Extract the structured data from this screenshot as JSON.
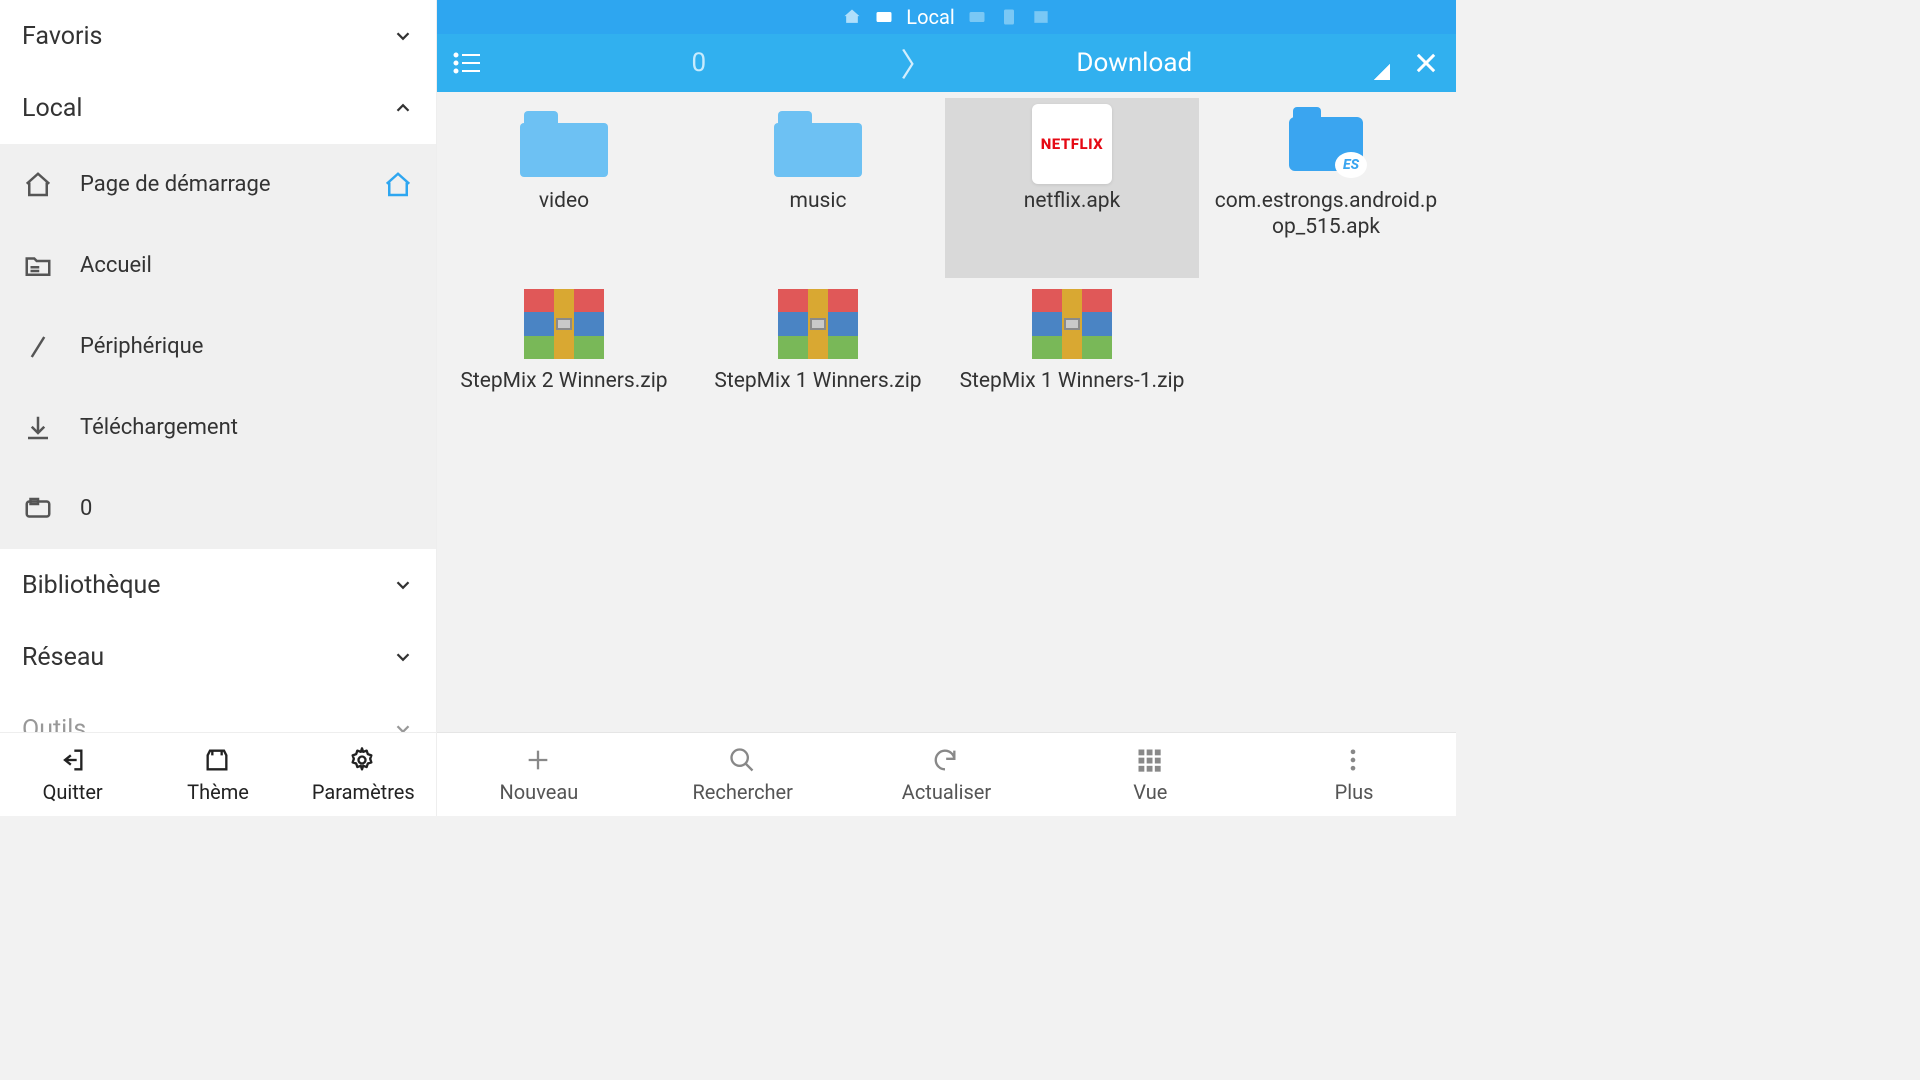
{
  "topbar": {
    "label": "Local"
  },
  "toolbar": {
    "breadcrumb": [
      {
        "label": "0",
        "active": false
      },
      {
        "label": "Download",
        "active": true
      }
    ]
  },
  "sidebar": {
    "groups": {
      "favoris": {
        "label": "Favoris",
        "expanded": false
      },
      "local": {
        "label": "Local",
        "expanded": true,
        "items": [
          {
            "label": "Page de démarrage",
            "icon": "home",
            "trail": "home",
            "active": true
          },
          {
            "label": "Accueil",
            "icon": "folder-list"
          },
          {
            "label": "Périphérique",
            "icon": "slash"
          },
          {
            "label": "Téléchargement",
            "icon": "download"
          },
          {
            "label": "0",
            "icon": "sd-card"
          }
        ]
      },
      "bibliotheque": {
        "label": "Bibliothèque",
        "expanded": false
      },
      "reseau": {
        "label": "Réseau",
        "expanded": false
      },
      "outils": {
        "label": "Outils",
        "expanded": false
      }
    },
    "bottom": {
      "quitter": "Quitter",
      "theme": "Thème",
      "parametres": "Paramètres"
    }
  },
  "files": [
    {
      "name": "video",
      "type": "folder"
    },
    {
      "name": "music",
      "type": "folder"
    },
    {
      "name": "netflix.apk",
      "type": "apk-netflix",
      "selected": true
    },
    {
      "name": "com.estrongs.android.pop_515.apk",
      "type": "apk-es"
    },
    {
      "name": "StepMix 2 Winners.zip",
      "type": "zip"
    },
    {
      "name": "StepMix 1 Winners.zip",
      "type": "zip"
    },
    {
      "name": "StepMix 1 Winners-1.zip",
      "type": "zip"
    }
  ],
  "main_bottom": {
    "nouveau": "Nouveau",
    "rechercher": "Rechercher",
    "actualiser": "Actualiser",
    "vue": "Vue",
    "plus": "Plus"
  }
}
